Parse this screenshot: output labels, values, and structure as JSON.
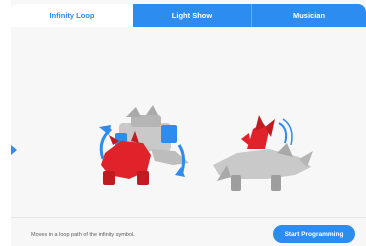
{
  "tabs": [
    {
      "label": "Infinity Loop",
      "active": true
    },
    {
      "label": "Light Show",
      "active": false
    },
    {
      "label": "Musician",
      "active": false
    }
  ],
  "footer": {
    "description": "Moves in a loop path of the infinity symbol.",
    "start_label": "Start Programming"
  },
  "colors": {
    "accent": "#2d8cf0",
    "robot_red": "#e0232b",
    "robot_gray": "#bdbdbd"
  },
  "icons": {
    "left_arrow": "caret-right-icon",
    "robot_1": "dinosaur-robot-loop-illustration",
    "robot_2": "dinosaur-robot-side-illustration"
  }
}
